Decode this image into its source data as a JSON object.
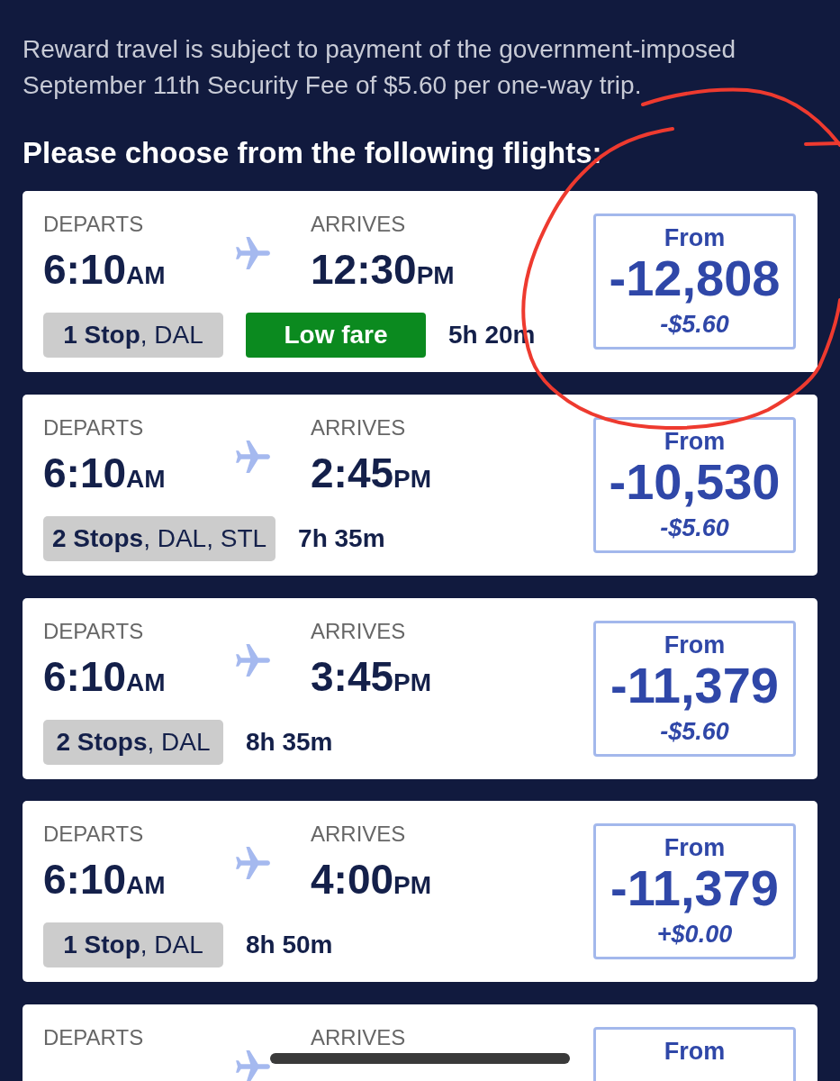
{
  "notice": "Reward travel is subject to payment of the government-imposed September 11th Security Fee of $5.60 per one-way trip.",
  "heading": "Please choose from the following flights:",
  "flights": [
    {
      "depart_label": "DEPARTS",
      "depart_time": "6:10",
      "depart_period": "AM",
      "arrive_label": "ARRIVES",
      "arrive_time": "12:30",
      "arrive_period": "PM",
      "stops": "**1 Stop**, DAL",
      "badge": "Low fare",
      "duration": "5h 20m",
      "price_label": "From",
      "points": "-12,808",
      "fee": "-$5.60",
      "circled": true
    },
    {
      "depart_label": "DEPARTS",
      "depart_time": "6:10",
      "depart_period": "AM",
      "arrive_label": "ARRIVES",
      "arrive_time": "2:45",
      "arrive_period": "PM",
      "stops": "**2 Stops**, DAL, STL",
      "duration": "7h 35m",
      "price_label": "From",
      "points": "-10,530",
      "fee": "-$5.60",
      "circled": false
    },
    {
      "depart_label": "DEPARTS",
      "depart_time": "6:10",
      "depart_period": "AM",
      "arrive_label": "ARRIVES",
      "arrive_time": "3:45",
      "arrive_period": "PM",
      "stops": "**2 Stops**, DAL",
      "duration": "8h 35m",
      "price_label": "From",
      "points": "-11,379",
      "fee": "-$5.60",
      "circled": false
    },
    {
      "depart_label": "DEPARTS",
      "depart_time": "6:10",
      "depart_period": "AM",
      "arrive_label": "ARRIVES",
      "arrive_time": "4:00",
      "arrive_period": "PM",
      "stops": "**1 Stop**, DAL",
      "duration": "8h 50m",
      "price_label": "From",
      "points": "-11,379",
      "fee": "+$0.00",
      "circled": false
    },
    {
      "depart_label": "DEPARTS",
      "arrive_label": "ARRIVES",
      "price_label": "From",
      "circled": false
    }
  ]
}
